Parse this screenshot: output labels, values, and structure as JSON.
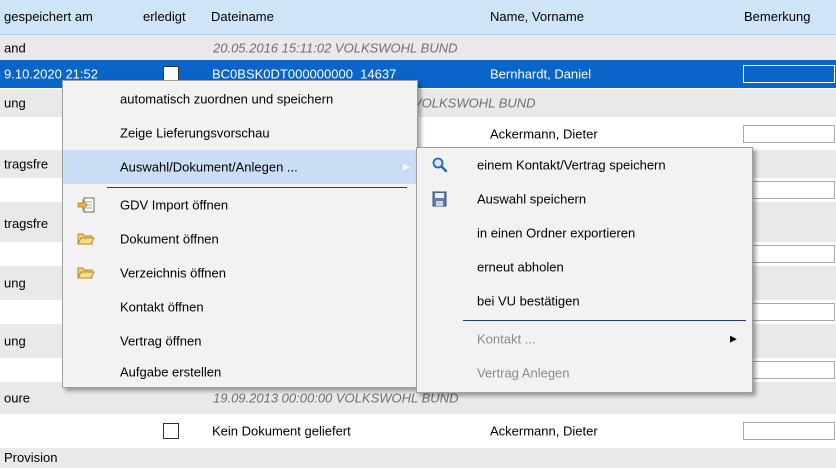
{
  "header": {
    "col_saved": "gespeichert am",
    "col_done": "erledigt",
    "col_file": "Dateiname",
    "col_name": "Name, Vorname",
    "col_remark": "Bemerkung"
  },
  "rows": [
    {
      "c0": "and",
      "file": "20.05.2016 15:11:02   VOLKSWOHL BUND"
    },
    {
      "c0": "9.10.2020 21:52",
      "file": "BC0BSK0DT000000000_14637",
      "name": "Bernhardt,  Daniel"
    },
    {
      "c0": "ung",
      "file": "VOLKSWOHL BUND"
    },
    {
      "c0": "",
      "name": "Ackermann,  Dieter"
    },
    {
      "c0": "tragsfre"
    },
    {
      "c0": ""
    },
    {
      "c0": "tragsfre"
    },
    {
      "c0": ""
    },
    {
      "c0": "ung"
    },
    {
      "c0": ""
    },
    {
      "c0": "ung"
    },
    {
      "c0": ""
    },
    {
      "c0": "oure",
      "file": "19.09.2013 00:00:00   VOLKSWOHL BUND"
    },
    {
      "c0": "",
      "file": "Kein Dokument geliefert",
      "name": "Ackermann,  Dieter"
    },
    {
      "c0": "Provision"
    }
  ],
  "context_menu": {
    "items": [
      {
        "label": "automatisch zuordnen und speichern"
      },
      {
        "label": "Zeige Lieferungsvorschau"
      },
      {
        "label": "Auswahl/Dokument/Anlegen ..."
      },
      {
        "label": "GDV Import öffnen",
        "icon": "import-icon"
      },
      {
        "label": "Dokument öffnen",
        "icon": "folder-icon"
      },
      {
        "label": "Verzeichnis öffnen",
        "icon": "folder-icon"
      },
      {
        "label": "Kontakt öffnen"
      },
      {
        "label": "Vertrag öffnen"
      },
      {
        "label": "Aufgabe erstellen"
      }
    ]
  },
  "submenu": {
    "items": [
      {
        "label": "einem Kontakt/Vertrag speichern",
        "icon": "search-icon"
      },
      {
        "label": "Auswahl speichern",
        "icon": "save-icon"
      },
      {
        "label": "in einen Ordner exportieren"
      },
      {
        "label": "erneut abholen"
      },
      {
        "label": "bei VU bestätigen"
      },
      {
        "label": "Kontakt ..."
      },
      {
        "label": "Vertrag Anlegen"
      }
    ]
  },
  "colors": {
    "selection": "#0a64c9",
    "menu_highlight": "#c9def5",
    "header": "#cfe4f7"
  }
}
